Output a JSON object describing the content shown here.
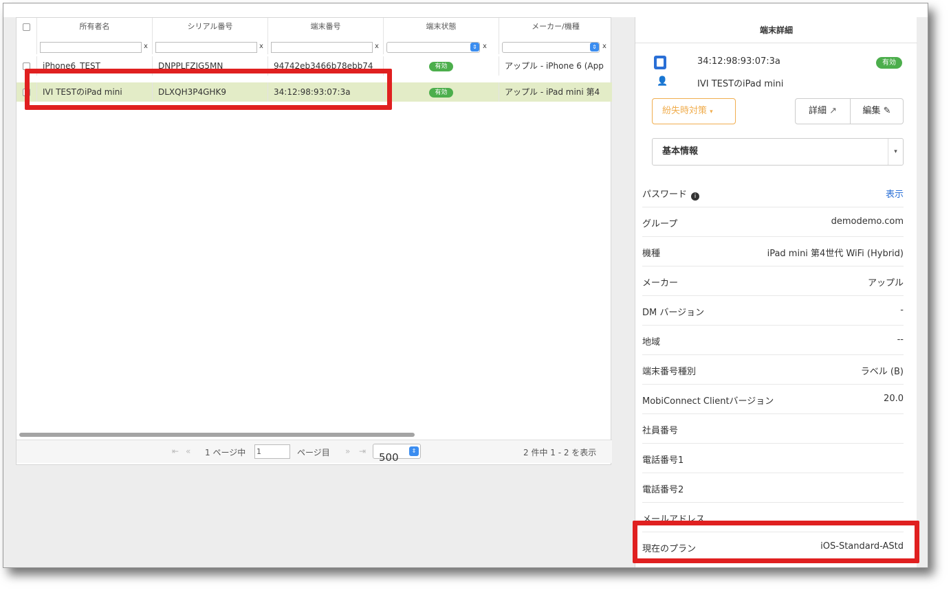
{
  "grid": {
    "columns": [
      "所有者名",
      "シリアル番号",
      "端末番号",
      "端末状態",
      "メーカー/機種"
    ],
    "filter_clear": "x",
    "rows": [
      {
        "owner": "iPhone6_TEST",
        "serial": "DNPPLFZJG5MN",
        "device_number": "94742eb3466b78ebb74",
        "status": "有効",
        "maker_model": "アップル - iPhone 6 (App"
      },
      {
        "owner": "IVI TESTのiPad mini",
        "serial": "DLXQH3P4GHK9",
        "device_number": "34:12:98:93:07:3a",
        "status": "有効",
        "maker_model": "アップル - iPad mini 第4"
      }
    ],
    "pager": {
      "first": "⇤",
      "prev": "«",
      "page_prefix": "1 ページ中",
      "page_value": "1",
      "page_suffix": "ページ目",
      "next": "»",
      "last": "⇥",
      "page_size": "500",
      "summary": "2 件中 1 - 2 を表示"
    }
  },
  "detail": {
    "title": "端末詳細",
    "device_number": "34:12:98:93:07:3a",
    "owner": "IVI TESTのiPad mini",
    "status": "有効",
    "lost_button": "紛失時対策",
    "details_button": "詳細",
    "edit_button": "編集",
    "section_select": "基本情報",
    "fields": [
      {
        "key": "パスワード",
        "value": "表示"
      },
      {
        "key": "グループ",
        "value": "demodemo.com"
      },
      {
        "key": "機種",
        "value": "iPad mini 第4世代 WiFi (Hybrid)"
      },
      {
        "key": "メーカー",
        "value": "アップル"
      },
      {
        "key": "DM バージョン",
        "value": "-"
      },
      {
        "key": "地域",
        "value": "--"
      },
      {
        "key": "端末番号種別",
        "value": "ラベル (B)"
      },
      {
        "key": "MobiConnect Clientバージョン",
        "value": "20.0"
      },
      {
        "key": "社員番号",
        "value": ""
      },
      {
        "key": "電話番号1",
        "value": ""
      },
      {
        "key": "電話番号2",
        "value": ""
      },
      {
        "key": "メールアドレス",
        "value": ""
      },
      {
        "key": "現在のプラン",
        "value": "iOS-Standard-AStd"
      }
    ]
  },
  "colors": {
    "active_badge": "#4cae4c",
    "selected_row": "#e3ecc7",
    "highlight": "#e02020",
    "lost_button": "#f0ad4e",
    "link": "#2a6fd6"
  }
}
